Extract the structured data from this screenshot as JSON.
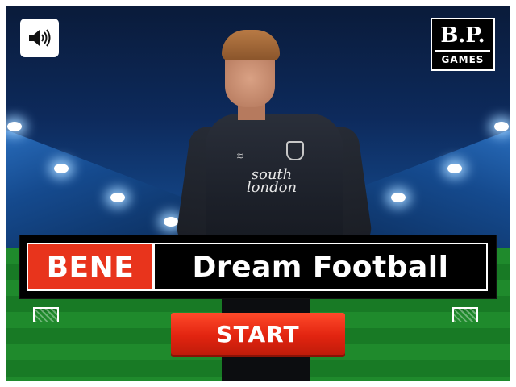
{
  "ui": {
    "sound_icon": "speaker-volume-icon",
    "logo_monogram": "B.P.",
    "logo_caption": "GAMES"
  },
  "title": {
    "prefix": "BENE",
    "main": "Dream Football"
  },
  "start_label": "START",
  "player": {
    "sponsor_text": "south london"
  },
  "colors": {
    "accent_red": "#e8341c",
    "banner_black": "#000000",
    "pitch_green": "#1f8a2c",
    "sky_blue": "#0d2a5c"
  }
}
